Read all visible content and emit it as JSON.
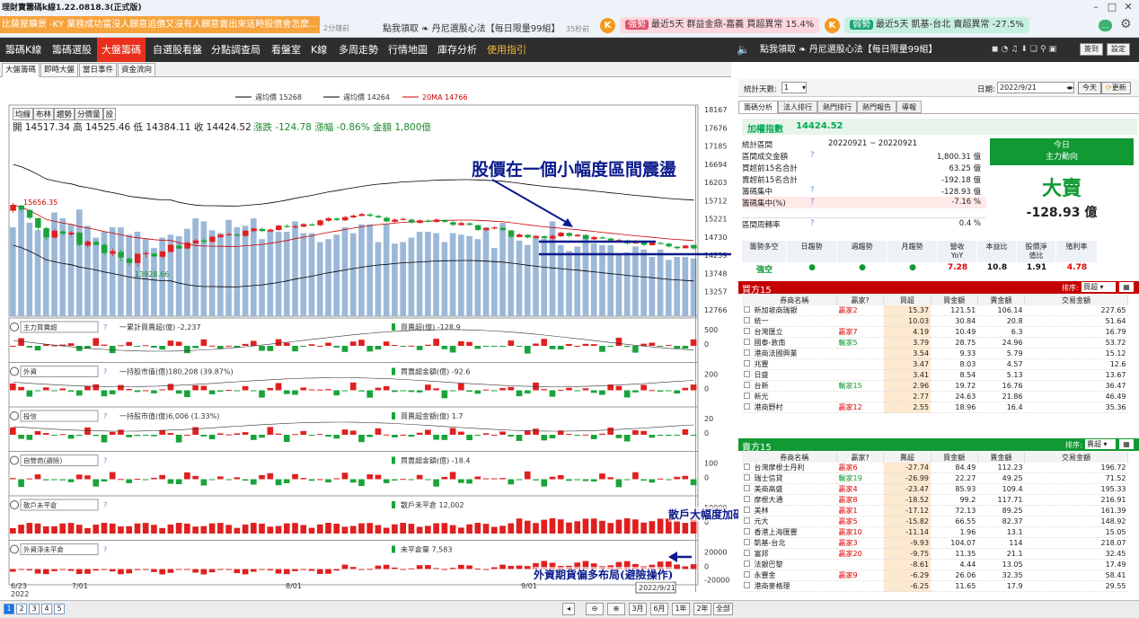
{
  "app": {
    "title": "理財寶籌碼k線1.22.0818.3(正式版)"
  },
  "ticker": {
    "text": "比薩屋曠景 -KY 業務成功富沒人願意追價又沒有人願意賣出來這時股價會怎麼...",
    "time": "2分鐘前",
    "promo_text": "點我領取 ❧ 丹尼選股心法【每日限量99組】",
    "promo_time": "35秒前",
    "pill1_tag": "強勢",
    "pill1_text": "最近5天 群益金鼎-嘉義 買超異常 15.4%",
    "pill2_tag": "弱勢",
    "pill2_text": "最近5天 凱基-台北 賣超異常 -27.5%",
    "k": "K"
  },
  "nav": {
    "items": [
      "籌碼K線",
      "籌碼選股",
      "大盤籌碼",
      "自選股看盤",
      "分點調查局",
      "看盤室",
      "K線",
      "多周走勢",
      "行情地圖",
      "庫存分析",
      "使用指引"
    ],
    "right_promo": "點我領取 ❧ 丹尼選股心法【每日限量99組】",
    "sign": "簽到",
    "settings": "設定"
  },
  "subtabs": [
    "大盤籌碼",
    "即時大盤",
    "當日事件",
    "資金流向"
  ],
  "chart_data": {
    "type": "bar",
    "legend": [
      {
        "name": "週均價 15268",
        "color": "#000"
      },
      {
        "name": "週均價 14264",
        "color": "#000"
      },
      {
        "name": "20MA 14766",
        "color": "#c00"
      }
    ],
    "period_buttons": [
      "均線",
      "布林",
      "趨勢",
      "分價量",
      "設"
    ],
    "ohlc_label": "開 14517.34 高 14525.46 低 14384.11 收 14424.52",
    "change": "漲跌 -124.78 漲幅 -0.86% 金額 1,800億",
    "high_mark": "15656.35",
    "low_mark": "13928.66",
    "ylabels": [
      "18167",
      "17676",
      "17185",
      "16694",
      "16203",
      "15712",
      "15221",
      "14730",
      "14239",
      "13748",
      "13257",
      "12766"
    ],
    "xlabels": [
      "6/23",
      "7/01",
      "8/01",
      "9/01"
    ],
    "x_year": "2022",
    "cursor_date": "2022/9/21",
    "annotation_main": "股價在一個小幅度區間震盪",
    "annotation_retail": "散戶大幅度加碼期貨多單",
    "annotation_foreign": "外資期貨偏多布局(避險操作)",
    "volume": [
      60,
      72,
      63,
      58,
      57,
      70,
      66,
      62,
      72,
      61,
      53,
      57,
      60,
      60,
      55,
      57,
      52,
      46,
      53,
      55,
      54,
      59,
      66,
      64,
      58,
      56,
      65,
      60,
      61,
      66,
      52,
      58,
      57,
      57,
      64,
      56,
      56,
      50,
      52,
      55,
      60,
      56,
      62,
      62,
      50,
      62,
      49,
      50,
      53,
      57,
      57,
      56,
      50,
      56,
      55,
      54,
      52,
      60,
      46,
      63,
      55,
      51,
      48,
      54,
      52,
      64,
      48,
      44,
      47,
      55,
      49,
      48,
      48,
      42,
      43,
      47,
      45,
      40,
      45,
      38,
      40,
      40,
      39
    ],
    "candles": [
      [
        15440,
        15600,
        15380,
        15656
      ],
      [
        15580,
        15470,
        15400,
        15600
      ],
      [
        15460,
        15250,
        15200,
        15480
      ],
      [
        15240,
        14980,
        14900,
        15250
      ],
      [
        14970,
        14720,
        14650,
        15010
      ],
      [
        14720,
        14900,
        14680,
        14950
      ],
      [
        14880,
        14820,
        14770,
        14920
      ],
      [
        14800,
        14850,
        14750,
        14900
      ],
      [
        14850,
        14520,
        14480,
        14860
      ],
      [
        14500,
        14610,
        14430,
        14650
      ],
      [
        14600,
        14520,
        14500,
        14640
      ],
      [
        14520,
        14300,
        14250,
        14560
      ],
      [
        14280,
        14350,
        14220,
        14420
      ],
      [
        14330,
        14180,
        14080,
        14400
      ],
      [
        14150,
        14030,
        13940,
        14200
      ],
      [
        14030,
        14280,
        13929,
        14300
      ],
      [
        14270,
        14300,
        14180,
        14350
      ],
      [
        14280,
        14210,
        14180,
        14320
      ],
      [
        14200,
        14340,
        14140,
        14360
      ],
      [
        14330,
        14520,
        14300,
        14540
      ],
      [
        14500,
        14420,
        14400,
        14550
      ],
      [
        14420,
        14580,
        14400,
        14620
      ],
      [
        14560,
        14640,
        14520,
        14680
      ],
      [
        14640,
        14600,
        14560,
        14700
      ],
      [
        14600,
        14740,
        14580,
        14760
      ],
      [
        14730,
        14790,
        14700,
        14820
      ],
      [
        14780,
        14810,
        14760,
        14850
      ],
      [
        14800,
        14770,
        14720,
        14830
      ],
      [
        14760,
        14900,
        14740,
        14920
      ],
      [
        14890,
        14960,
        14860,
        14990
      ],
      [
        14950,
        14890,
        14860,
        14990
      ],
      [
        14880,
        14930,
        14860,
        14960
      ],
      [
        14920,
        15040,
        14900,
        15060
      ],
      [
        15030,
        15000,
        14980,
        15080
      ],
      [
        14990,
        15020,
        14960,
        15060
      ],
      [
        15010,
        15080,
        14990,
        15110
      ],
      [
        15070,
        15050,
        15030,
        15110
      ],
      [
        15050,
        15180,
        15020,
        15200
      ],
      [
        15170,
        15240,
        15140,
        15260
      ],
      [
        15230,
        15190,
        15160,
        15260
      ],
      [
        15180,
        15270,
        15160,
        15300
      ],
      [
        15260,
        15310,
        15230,
        15340
      ],
      [
        15300,
        15350,
        15280,
        15380
      ],
      [
        15340,
        15300,
        15270,
        15380
      ],
      [
        15300,
        15260,
        15230,
        15330
      ],
      [
        15250,
        15150,
        15120,
        15280
      ],
      [
        15140,
        15200,
        15110,
        15240
      ],
      [
        15190,
        15220,
        15180,
        15260
      ],
      [
        15200,
        15120,
        15090,
        15230
      ],
      [
        15110,
        15180,
        15100,
        15210
      ],
      [
        15170,
        15150,
        15120,
        15220
      ],
      [
        15140,
        15200,
        15110,
        15240
      ],
      [
        15190,
        15140,
        15120,
        15210
      ],
      [
        15130,
        15060,
        15020,
        15160
      ],
      [
        15050,
        15110,
        15040,
        15150
      ],
      [
        15100,
        15060,
        15040,
        15130
      ],
      [
        15050,
        14920,
        14900,
        15080
      ],
      [
        14920,
        14970,
        14880,
        15000
      ],
      [
        14960,
        14990,
        14930,
        15020
      ],
      [
        14980,
        14920,
        14890,
        15010
      ],
      [
        14910,
        14740,
        14700,
        14920
      ],
      [
        14730,
        14800,
        14720,
        14830
      ],
      [
        14790,
        14720,
        14690,
        14800
      ],
      [
        14710,
        14760,
        14680,
        14790
      ],
      [
        14750,
        14700,
        14660,
        14780
      ],
      [
        14690,
        14760,
        14660,
        14800
      ],
      [
        14750,
        14850,
        14730,
        14870
      ],
      [
        14840,
        14760,
        14720,
        14860
      ],
      [
        14750,
        14790,
        14740,
        14820
      ],
      [
        14780,
        14680,
        14640,
        14800
      ],
      [
        14670,
        14730,
        14650,
        14760
      ],
      [
        14720,
        14700,
        14680,
        14760
      ],
      [
        14690,
        14640,
        14600,
        14720
      ],
      [
        14630,
        14650,
        14600,
        14690
      ],
      [
        14640,
        14560,
        14520,
        14660
      ],
      [
        14560,
        14620,
        14550,
        14650
      ],
      [
        14610,
        14520,
        14480,
        14640
      ],
      [
        14510,
        14580,
        14500,
        14610
      ],
      [
        14570,
        14560,
        14540,
        14600
      ],
      [
        14550,
        14480,
        14440,
        14580
      ],
      [
        14470,
        14430,
        14380,
        14490
      ],
      [
        14430,
        14500,
        14420,
        14520
      ],
      [
        14517,
        14424,
        14384,
        14525
      ]
    ],
    "subcharts": [
      {
        "select": "主力買賣超",
        "q": "?",
        "label1": "一累計買賣超(億) -2,237",
        "label2": "買賣超(億) -128.9",
        "ylabels": [
          "500",
          "0"
        ]
      },
      {
        "select": "外資",
        "q": "?",
        "label1": "一持股市值(億)180,208 (39.87%)",
        "label2": "買賣超金額(億) -92.6",
        "ylabels": [
          "200",
          "0"
        ]
      },
      {
        "select": "投信",
        "q": "?",
        "label1": "一持股市值(億)6,006 (1.33%)",
        "label2": "買賣超金額(億) 1.7",
        "ylabels": [
          "20",
          "0"
        ]
      },
      {
        "select": "自營商(避險)",
        "q": "?",
        "label1": "",
        "label2": "買賣超金額(億) -18.4",
        "ylabels": [
          "100",
          "0"
        ]
      },
      {
        "select": "散戶未平倉",
        "q": "?",
        "label1": "",
        "label2": "散戶未平倉 12,002",
        "ylabels": [
          "50000",
          "0"
        ]
      },
      {
        "select": "外資淨未平倉",
        "q": "?",
        "label1": "",
        "label2": "未平倉量 7,583",
        "ylabels": [
          "20000",
          "0",
          "-20000"
        ]
      }
    ]
  },
  "bottom": {
    "pages": [
      "1",
      "2",
      "3",
      "4",
      "5"
    ],
    "zoom_buttons": [
      "3月",
      "6月",
      "1年",
      "2年",
      "全部"
    ]
  },
  "right": {
    "stat_days_label": "統計天數:",
    "stat_days_value": "1",
    "date_label": "日期:",
    "date_value": "2022/9/21",
    "today_btn": "今天",
    "refresh_btn": "更新",
    "tabs": [
      "籌碼分析",
      "法人排行",
      "熱門排行",
      "熱門報告",
      "導報"
    ],
    "index_name": "加權指數",
    "index_value": "14424.52",
    "stats": [
      {
        "k": "統計區間",
        "v": "20220921 ~ 20220921",
        "q": ""
      },
      {
        "k": "區間成交金額",
        "v": "1,800.31 億",
        "q": "?"
      },
      {
        "k": "買超前15名合計",
        "v": "63.25 億",
        "q": ""
      },
      {
        "k": "賣超前15名合計",
        "v": "-192.18 億",
        "q": ""
      },
      {
        "k": "籌碼集中",
        "v": "-128.93 億",
        "q": "?"
      },
      {
        "k": "籌碼集中(%)",
        "v": "-7.16 %",
        "q": "?"
      },
      {
        "k": "區間周轉率",
        "v": "0.4 %",
        "q": "?"
      }
    ],
    "main_force": {
      "title": "今日",
      "subtitle": "主力動向",
      "verdict": "大賣",
      "value": "-128.93 億"
    },
    "trend_headers": [
      "籌勢多空",
      "日趨勢",
      "週趨勢",
      "月趨勢",
      "營收YoY",
      "本益比",
      "股價淨值比",
      "殖利率"
    ],
    "trend_values": [
      "強空",
      "●",
      "●",
      "●",
      "7.28",
      "10.8",
      "1.91",
      "4.78"
    ],
    "buy_title": "買方15",
    "sell_title": "賣方15",
    "sort_label": "排序:",
    "sort_value": "買超",
    "sort_value2": "賣超",
    "table_headers": [
      "券商名稱",
      "贏家?",
      "買超",
      "買金額",
      "賣金額",
      "交易金額"
    ],
    "table_headers_sell": [
      "券商名稱",
      "贏家?",
      "賣超",
      "買金額",
      "賣金額",
      "交易金額"
    ],
    "buy_rows": [
      [
        "新加坡商瑞銀",
        "贏家2",
        "15.37",
        "121.51",
        "106.14",
        "227.65"
      ],
      [
        "統一",
        "",
        "10.03",
        "30.84",
        "20.8",
        "51.64"
      ],
      [
        "台灣匯立",
        "贏家7",
        "4.19",
        "10.49",
        "6.3",
        "16.79"
      ],
      [
        "國泰-敦南",
        "輸家5",
        "3.79",
        "28.75",
        "24.96",
        "53.72"
      ],
      [
        "港商法國興業",
        "",
        "3.54",
        "9.33",
        "5.79",
        "15.12"
      ],
      [
        "兆豐",
        "",
        "3.47",
        "8.03",
        "4.57",
        "12.6"
      ],
      [
        "日盛",
        "",
        "3.41",
        "8.54",
        "5.13",
        "13.67"
      ],
      [
        "台新",
        "輸家15",
        "2.96",
        "19.72",
        "16.76",
        "36.47"
      ],
      [
        "新光",
        "",
        "2.77",
        "24.63",
        "21.86",
        "46.49"
      ],
      [
        "港商野村",
        "贏家12",
        "2.55",
        "18.96",
        "16.4",
        "35.36"
      ]
    ],
    "sell_rows": [
      [
        "台灣摩根士丹利",
        "贏家6",
        "-27.74",
        "84.49",
        "112.23",
        "196.72"
      ],
      [
        "瑞士信貸",
        "輸家19",
        "-26.99",
        "22.27",
        "49.25",
        "71.52"
      ],
      [
        "美商高盛",
        "贏家4",
        "-23.47",
        "85.93",
        "109.4",
        "195.33"
      ],
      [
        "摩根大通",
        "贏家8",
        "-18.52",
        "99.2",
        "117.71",
        "216.91"
      ],
      [
        "美林",
        "贏家1",
        "-17.12",
        "72.13",
        "89.25",
        "161.39"
      ],
      [
        "元大",
        "贏家5",
        "-15.82",
        "66.55",
        "82.37",
        "148.92"
      ],
      [
        "香港上海匯豐",
        "贏家10",
        "-11.14",
        "1.96",
        "13.1",
        "15.05"
      ],
      [
        "凱基-台北",
        "贏家3",
        "-9.93",
        "104.07",
        "114",
        "218.07"
      ],
      [
        "富邦",
        "贏家20",
        "-9.75",
        "11.35",
        "21.1",
        "32.45"
      ],
      [
        "法銀巴黎",
        "",
        "-8.61",
        "4.44",
        "13.05",
        "17.49"
      ],
      [
        "永豐金",
        "贏家9",
        "-6.29",
        "26.06",
        "32.35",
        "58.41"
      ],
      [
        "港商麥格理",
        "",
        "-6.25",
        "11.65",
        "17.9",
        "29.55"
      ]
    ]
  },
  "colors": {
    "up": "#e02020",
    "down": "#1aa33a",
    "vol": "#9cb8d8",
    "accent": "#e8301c",
    "annotation": "#0b1a8c"
  }
}
